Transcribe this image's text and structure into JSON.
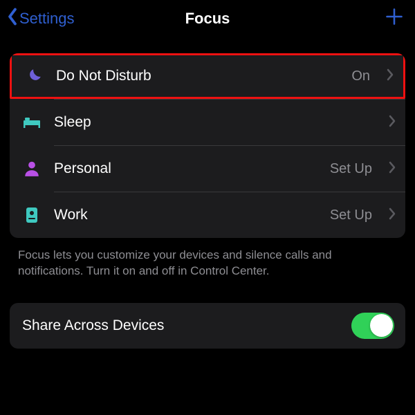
{
  "nav": {
    "back_label": "Settings",
    "title": "Focus"
  },
  "focus_modes": [
    {
      "label": "Do Not Disturb",
      "status": "On",
      "icon": "moon",
      "icon_color": "#6e5fd8",
      "highlight": true
    },
    {
      "label": "Sleep",
      "status": "",
      "icon": "bed",
      "icon_color": "#3fc9c0",
      "highlight": false
    },
    {
      "label": "Personal",
      "status": "Set Up",
      "icon": "person",
      "icon_color": "#b950e6",
      "highlight": false
    },
    {
      "label": "Work",
      "status": "Set Up",
      "icon": "badge",
      "icon_color": "#3fc9c0",
      "highlight": false
    }
  ],
  "footer": "Focus lets you customize your devices and silence calls and notifications. Turn it on and off in Control Center.",
  "share": {
    "label": "Share Across Devices",
    "on": true
  }
}
